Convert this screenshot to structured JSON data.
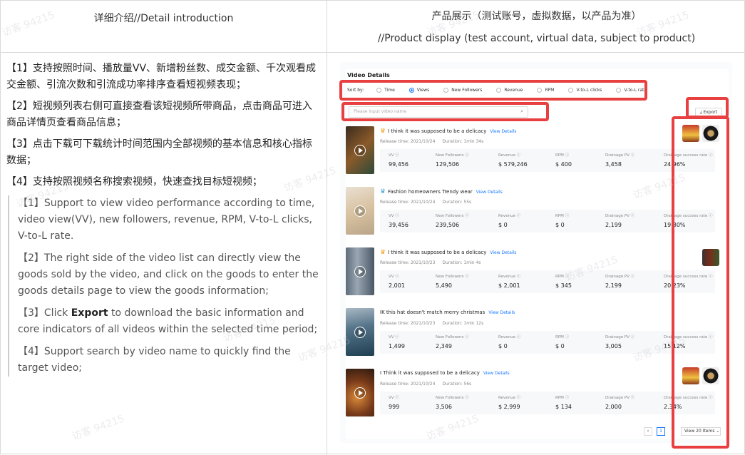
{
  "header": {
    "left": "详细介绍//Detail introduction",
    "right_line1": "产品展示（测试账号，虚拟数据，以产品为准）",
    "right_line2": "//Product display (test account, virtual data, subject to product)"
  },
  "zh_points": [
    "【1】支持按照时间、播放量VV、新增粉丝数、成交金额、千次观看成交金额、引流次数和引流成功率排序查看短视频表现；",
    "【2】短视频列表右侧可直接查看该短视频所带商品，点击商品可进入商品详情页查看商品信息；",
    "【3】点击下载可下载统计时间范围内全部视频的基本信息和核心指标数据；",
    "【4】支持按照视频名称搜索视频，快速查找目标短视频；"
  ],
  "en_points": {
    "p1": "【1】Support to view video performance according to time, video view(VV), new followers, revenue, RPM, V-to-L clicks, V-to-L rate.",
    "p2": "【2】The right side of the video list can directly view the goods sold by the video, and click on the goods to enter the goods details page to view the goods information;",
    "p3_pre": "【3】Click ",
    "p3_bold": "Export",
    "p3_post": " to download the basic information and core indicators of all videos within the selected time period;",
    "p4": "【4】Support search by video name to quickly find the target video;"
  },
  "panel": {
    "title": "Video Details",
    "sort_label": "Sort by:",
    "sort_options": [
      "Time",
      "Views",
      "New Followers",
      "Revenue",
      "RPM",
      "V-to-L clicks",
      "V-to-L rate"
    ],
    "search_placeholder": "Please input video name",
    "export_label": "Export",
    "view_details": "View Details",
    "stat_labels": [
      "VV ⓘ",
      "New Followers ⓘ",
      "Revenue ⓘ",
      "RPM ⓘ",
      "Drainage PV ⓘ",
      "Drainage success rate ⓘ"
    ],
    "videos": [
      {
        "title": "I think it was supposed to be a delicacy",
        "release": "Release time: 2021/10/24",
        "duration": "Duration: 1min 34s",
        "stats": [
          "99,456",
          "129,506",
          "$ 579,246",
          "$ 400",
          "3,458",
          "24.96%"
        ]
      },
      {
        "title": "Fashion homeowners Trendy wear",
        "release": "Release time: 2021/10/24",
        "duration": "Duration: 55s",
        "stats": [
          "39,456",
          "239,506",
          "$ 0",
          "$ 0",
          "2,199",
          "19.80%"
        ]
      },
      {
        "title": "I think it was supposed to be a delicacy",
        "release": "Release time: 2021/10/23",
        "duration": "Duration: 1min 4s",
        "stats": [
          "2,001",
          "5,490",
          "$ 2,001",
          "$ 345",
          "2,199",
          "20.23%"
        ]
      },
      {
        "title": "IK this hat doesn't match merry christmas",
        "release": "Release time: 2021/10/23",
        "duration": "Duration: 1min 12s",
        "stats": [
          "1,499",
          "2,349",
          "$ 0",
          "$ 0",
          "3,005",
          "15.12%"
        ]
      },
      {
        "title": "I Think it was supposed to be a delicacy",
        "release": "Release time: 2021/10/24",
        "duration": "Duration: 56s",
        "stats": [
          "999",
          "3,506",
          "$ 2,999",
          "$ 134",
          "2,000",
          "2.34%"
        ]
      }
    ],
    "page": "1",
    "page_size": "View 20 Items"
  },
  "watermark": "访客 94215",
  "colors": {
    "highlight": "#e84040",
    "accent": "#1677ff"
  }
}
